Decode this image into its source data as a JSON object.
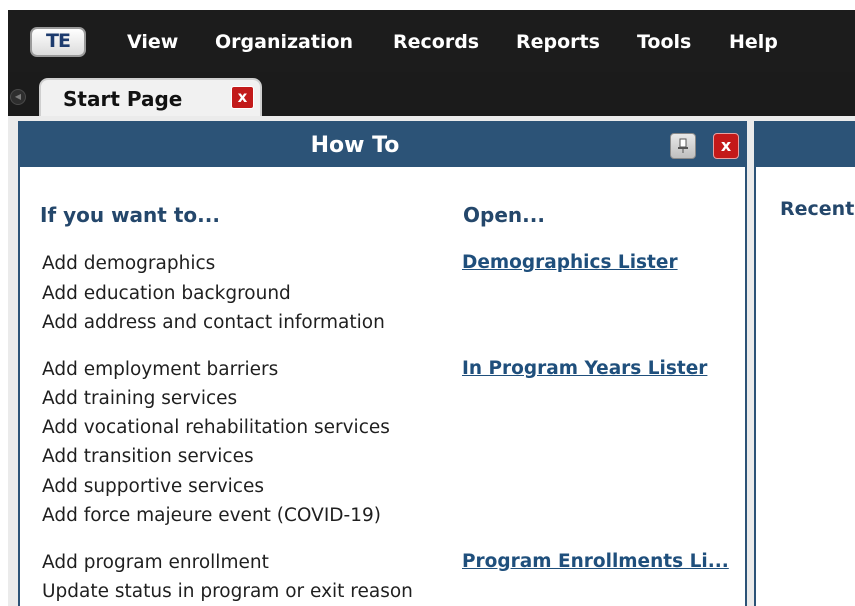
{
  "app": {
    "logo_text": "TE"
  },
  "menu": [
    "View",
    "Organization",
    "Records",
    "Reports",
    "Tools",
    "Help"
  ],
  "tabs": [
    {
      "label": "Start Page",
      "close": "x"
    }
  ],
  "howto": {
    "title": "How To",
    "col_want": "If you want to...",
    "col_open": "Open...",
    "groups": [
      {
        "items": [
          "Add demographics",
          "Add education background",
          "Add address and contact information"
        ],
        "link": "Demographics Lister"
      },
      {
        "items": [
          "Add employment barriers",
          "Add training services",
          "Add vocational rehabilitation services",
          "Add transition services",
          "Add supportive services",
          "Add force majeure event (COVID-19)"
        ],
        "link": "In Program Years Lister"
      },
      {
        "items": [
          "Add program enrollment",
          "Update status in program or exit reason"
        ],
        "link": "Program Enrollments Li..."
      }
    ],
    "close": "x"
  },
  "recent_panel": {
    "label": "Recent"
  },
  "colors": {
    "header_blue": "#2c5377",
    "close_red": "#c41919",
    "link_blue": "#1f4f7c"
  }
}
